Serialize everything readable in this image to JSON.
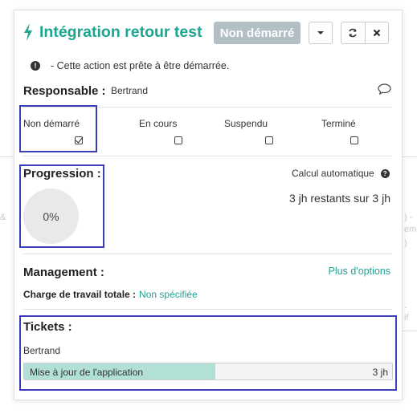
{
  "background": {
    "fragments": [
      "&",
      ") -",
      "eme",
      "-",
      "if",
      ")"
    ]
  },
  "header": {
    "title": "Intégration retour test",
    "status_button": "Non démarré",
    "icons": [
      "bolt-icon",
      "chevron-down-icon",
      "refresh-icon",
      "close-icon"
    ]
  },
  "notice": {
    "text": "- Cette action est prête à être démarrée."
  },
  "responsable": {
    "label": "Responsable :",
    "name": "Bertrand"
  },
  "statuses": [
    {
      "label": "Non démarré",
      "checked": true
    },
    {
      "label": "En cours",
      "checked": false
    },
    {
      "label": "Suspendu",
      "checked": false
    },
    {
      "label": "Terminé",
      "checked": false
    }
  ],
  "progression": {
    "label": "Progression :",
    "percent": "0%",
    "calc_label": "Calcul automatique",
    "remaining": "3 jh restants sur 3 jh"
  },
  "management": {
    "label": "Management :",
    "more_link": "Plus d'options",
    "workload_label": "Charge de travail totale :",
    "workload_value": "Non spécifiée"
  },
  "tickets": {
    "label": "Tickets :",
    "assignee": "Bertrand",
    "items": [
      {
        "name": "Mise à jour de l'application",
        "duration": "3 jh",
        "progress": 0.52
      }
    ]
  },
  "colors": {
    "accent": "#1fa590",
    "status_button": "#b2bfc4",
    "ticket_fill": "#b1e0d6",
    "highlight": "#3b3fb5"
  }
}
